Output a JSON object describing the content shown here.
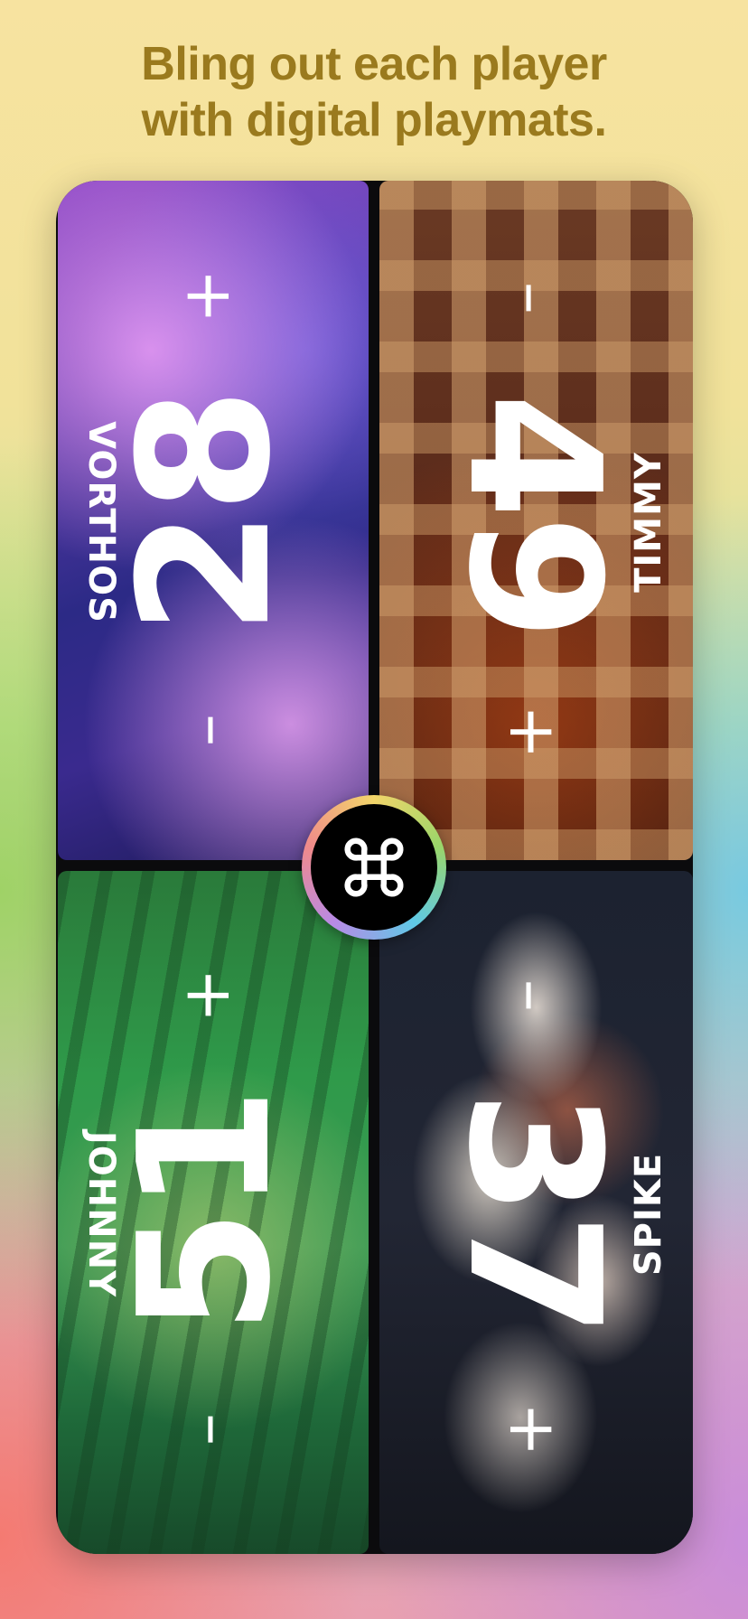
{
  "headline": {
    "line1": "Bling out each player",
    "line2": "with digital playmats."
  },
  "players": [
    {
      "id": "top-left",
      "name": "VORTHOS",
      "life": "28",
      "minus": "–",
      "plus": "+"
    },
    {
      "id": "top-right",
      "name": "TIMMY",
      "life": "49",
      "minus": "–",
      "plus": "+"
    },
    {
      "id": "bottom-left",
      "name": "JOHNNY",
      "life": "51",
      "minus": "–",
      "plus": "+"
    },
    {
      "id": "bottom-right",
      "name": "SPIKE",
      "life": "37",
      "minus": "–",
      "plus": "+"
    }
  ],
  "center_button": {
    "icon": "command-icon"
  },
  "colors": {
    "headline": "#9a7a1e",
    "text": "#ffffff"
  }
}
